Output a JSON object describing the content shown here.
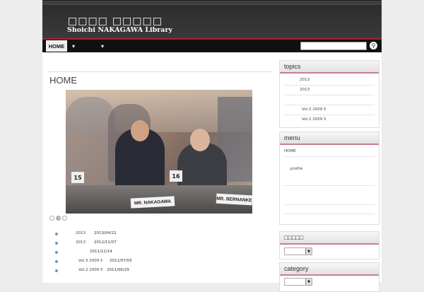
{
  "site": {
    "title_jp": "□□□□ □□□□□",
    "title_en": "Shoichi NAKAGAWA Library"
  },
  "nav": {
    "home": "HOME",
    "menu1_chevron": "chevron-down-icon",
    "menu2_chevron": "chevron-down-icon",
    "search_placeholder": "",
    "search_icon": "search-icon"
  },
  "main": {
    "page_title": "HOME",
    "slide": {
      "name_card_left": "MR. NAKAGAWA",
      "name_card_right": "MR. BERNANKE",
      "number_left": "15",
      "number_right": "16"
    },
    "slideshow_dots": 3,
    "news": [
      {
        "title": "2013",
        "date": "2013/04/22"
      },
      {
        "title": "2013",
        "date": "2012/11/07"
      },
      {
        "title": "",
        "date": "2011/12/14"
      },
      {
        "title": "Vol.3 2009 5",
        "date": "2011/07/05"
      },
      {
        "title": "Vol.2 2009 5",
        "date": "2011/06/29"
      }
    ]
  },
  "sidebar": {
    "topics": {
      "heading": "topics",
      "items": [
        "2013",
        "2013",
        "",
        "Vol.3 2009 5",
        "Vol.2 2009 5"
      ]
    },
    "menu": {
      "heading": "menu",
      "items": [
        "HOME",
        "profile"
      ]
    },
    "archive": {
      "heading": "□□□□□"
    },
    "category": {
      "heading": "category"
    }
  },
  "colors": {
    "accent_red": "#b2222a",
    "header_dark": "#2b2b2b",
    "bullet_blue": "#5a9bd4"
  }
}
